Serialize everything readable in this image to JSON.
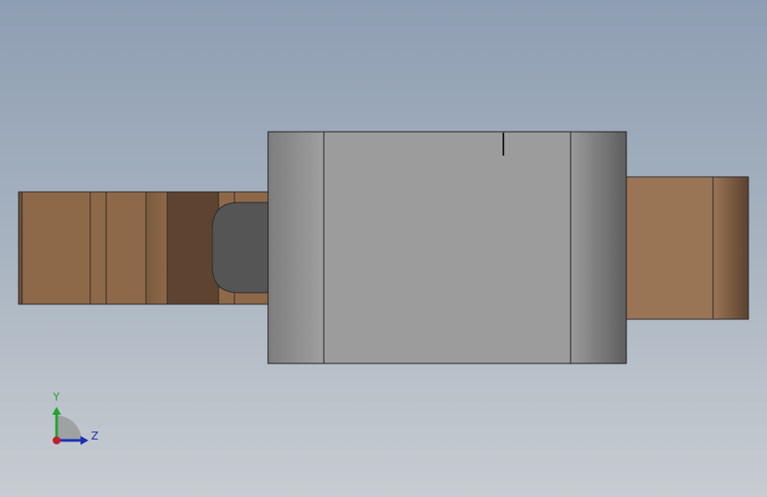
{
  "viewport": {
    "background_top": "#8e9eb2",
    "background_bottom": "#c7ccd1"
  },
  "model": {
    "shaft_color": "#8e6949",
    "shaft_dark_color": "#5e4430",
    "right_shaft_color": "#9a7555",
    "body_color": "#9c9c9c",
    "body_edge_color": "#6c6c6c",
    "slot_color": "#555555"
  },
  "triad": {
    "y_label": "Y",
    "z_label": "Z",
    "y_color": "#1fa52a",
    "z_color": "#1c2fb5",
    "origin_color": "#c0202a",
    "icon": "coordinate-triad-icon"
  }
}
